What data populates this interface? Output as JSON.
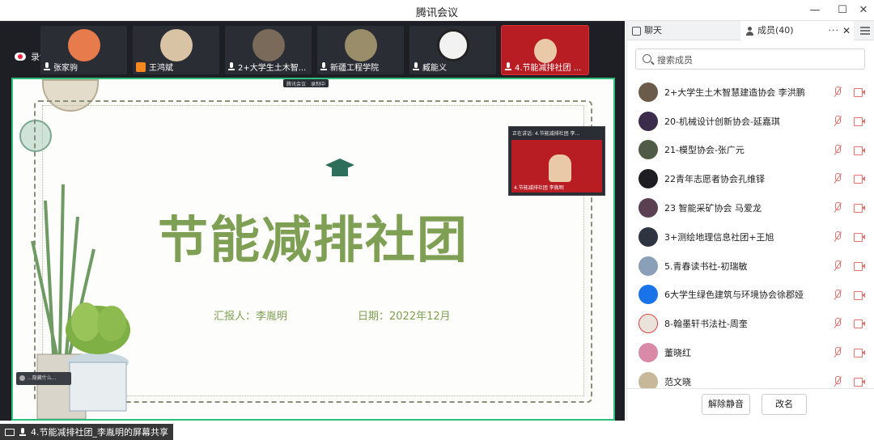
{
  "window": {
    "title": "腾讯会议",
    "minimize": "—",
    "maximize": "☐",
    "close": "✕"
  },
  "stage": {
    "recording_label": "录制中",
    "tiles": [
      {
        "name": "张家驹",
        "avatar_color": "#e87b4c",
        "mic": "mic-icon"
      },
      {
        "name": "王鸿斌",
        "avatar_color": "#d9c3a5",
        "mic": "person-icon"
      },
      {
        "name": "2+大学生土木智...",
        "avatar_color": "#7a6a5a",
        "mic": "mic-icon"
      },
      {
        "name": "新疆工程学院",
        "avatar_color": "#9a8d6a",
        "mic": "mic-icon"
      },
      {
        "name": "臧能义",
        "avatar_color": "#f2f2f2",
        "mic": "mic-icon"
      },
      {
        "name": "4.节能减排社团 ...",
        "avatar_color": "#b81d24",
        "mic": "mic-icon"
      }
    ],
    "share_info": [
      "腾讯会议",
      "录制中"
    ],
    "speaker": {
      "label": "正在讲话: 4.节能减排社团 李...",
      "name": "4.节能减排社团 李胤明"
    },
    "hide_chip": "...隐藏什么...",
    "bottom_label": "4.节能减排社团_李胤明的屏幕共享"
  },
  "slide": {
    "title": "节能减排社团",
    "reporter": "汇报人：李胤明",
    "date": "日期：2022年12月"
  },
  "panel": {
    "tab_chat": "聊天",
    "tab_members": "成员(40)",
    "more": "···",
    "close": "✕",
    "search_placeholder": "搜索成员",
    "members": [
      {
        "name": "2+大学生土木智慧建造协会 李洪鹏",
        "avatar_color": "#6b5b4a"
      },
      {
        "name": "20-机械设计创新协会-延嘉琪",
        "avatar_color": "#3a2c4a"
      },
      {
        "name": "21-模型协会-张广元",
        "avatar_color": "#4f5b46"
      },
      {
        "name": "22青年志愿者协会孔维铎",
        "avatar_color": "#1e1e22"
      },
      {
        "name": "23  智能采矿协会    马爱龙",
        "avatar_color": "#5a4050"
      },
      {
        "name": "3+测绘地理信息社团+王旭",
        "avatar_color": "#2f3540"
      },
      {
        "name": "5.青春读书社-初瑞敏",
        "avatar_color": "#8aa0b8"
      },
      {
        "name": "6大学生绿色建筑与环境协会徐郡娅",
        "avatar_color": "#1a73e8"
      },
      {
        "name": "8-翰墨轩书法社-周奎",
        "avatar_color": "#e9e3da"
      },
      {
        "name": "董晓红",
        "avatar_color": "#d98aa6"
      },
      {
        "name": "范文晓",
        "avatar_color": "#c8b89a"
      }
    ],
    "btn_unmute": "解除静音",
    "btn_rename": "改名"
  }
}
